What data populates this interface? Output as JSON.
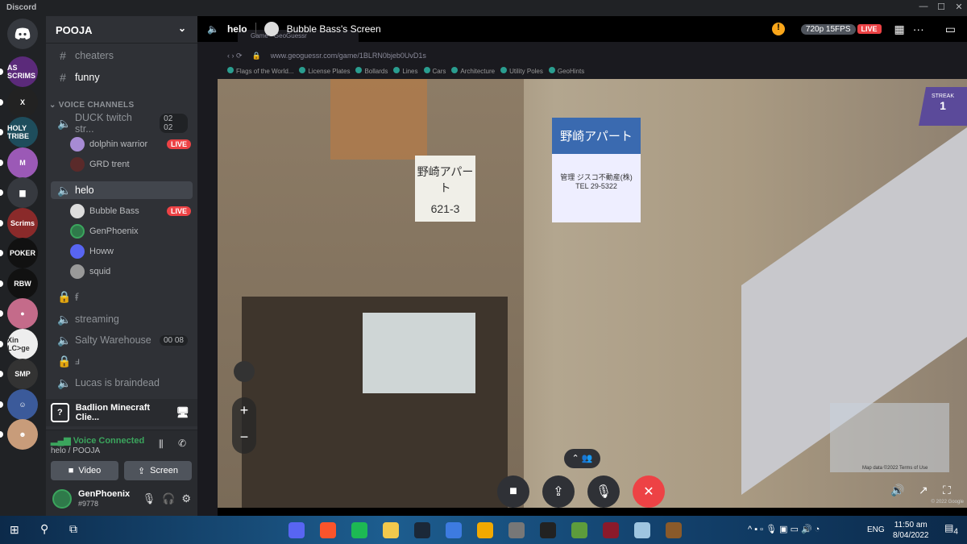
{
  "app": {
    "title": "Discord",
    "window_controls": [
      "—",
      "☐",
      "✕"
    ]
  },
  "servers": [
    {
      "label": "AS SCRIMS",
      "color": "#5b2a7a"
    },
    {
      "label": "X",
      "color": "#222"
    },
    {
      "label": "HOLY TRIBE",
      "color": "#1e4d5c"
    },
    {
      "label": "M",
      "color": "#9b59b6"
    },
    {
      "label": "▆",
      "color": "#36393f"
    },
    {
      "label": "Scrims",
      "color": "#8a2a2a"
    },
    {
      "label": "POKER",
      "color": "#111"
    },
    {
      "label": "RBW",
      "color": "#111"
    },
    {
      "label": "●",
      "color": "#c46b8a"
    },
    {
      "label": "Xin LC>ge",
      "color": "#eee"
    },
    {
      "label": "SMP",
      "color": "#333"
    },
    {
      "label": "☺",
      "color": "#3b5a9a"
    },
    {
      "label": "☻",
      "color": "#c89c7a"
    }
  ],
  "sidebar": {
    "server_name": "POOJA",
    "text_channels": [
      {
        "name": "cheaters"
      },
      {
        "name": "funny"
      }
    ],
    "category": "VOICE CHANNELS",
    "voice": [
      {
        "name": "DUCK twitch str...",
        "count_a": "02",
        "count_b": "02",
        "users": [
          {
            "name": "dolphin warrior",
            "live": "LIVE"
          },
          {
            "name": "GRD trent"
          }
        ]
      },
      {
        "name": "helo",
        "users": [
          {
            "name": "Bubble Bass",
            "live": "LIVE"
          },
          {
            "name": "GenPhoenix"
          },
          {
            "name": "Howw"
          },
          {
            "name": "squid"
          }
        ]
      },
      {
        "name": "ꞙ",
        "locked": true
      },
      {
        "name": "streaming"
      },
      {
        "name": "Salty Warehouse",
        "count_a": "00",
        "count_b": "08"
      },
      {
        "name": "ⅎ",
        "locked": true
      },
      {
        "name": "Lucas is braindead"
      }
    ],
    "activity": "Badlion Minecraft Clie...",
    "voice_status": {
      "title": "Voice Connected",
      "location": "helo / POOJA",
      "video": "Video",
      "screen": "Screen"
    },
    "user": {
      "name": "GenPhoenix",
      "tag": "#9778"
    }
  },
  "stream": {
    "channel": "helo",
    "screen_title": "Bubble Bass's Screen",
    "quality": "720p 15FPS",
    "live": "LIVE",
    "browser": {
      "tab": "Game - GeoGuessr",
      "url": "www.geoguessr.com/game/1BLRN0bjeb0UvD1s",
      "bookmarks": [
        "Flags of the World...",
        "License Plates",
        "Bollards",
        "Lines",
        "Cars",
        "Architecture",
        "Utility Poles",
        "GeoHints"
      ]
    },
    "game": {
      "streak_label": "STREAK",
      "streak": "1",
      "sign1_a": "野崎アパート",
      "sign1_b": "621-3",
      "sign2_a": "野崎アパート",
      "sign2_b": "管理 ジスコ不動産(株)",
      "sign2_c": "TEL 29-5322",
      "map_label": "Map data ©2022",
      "map_terms": "Terms of Use",
      "google": "© 2022 Google"
    }
  },
  "taskbar": {
    "time": "11:50 am",
    "date": "8/04/2022",
    "lang": "ENG",
    "notifications": "4"
  },
  "colors": {
    "live": "#ed4245",
    "voice_connected": "#3ba55d",
    "end_call": "#ed4245",
    "accent": "#5865f2"
  }
}
